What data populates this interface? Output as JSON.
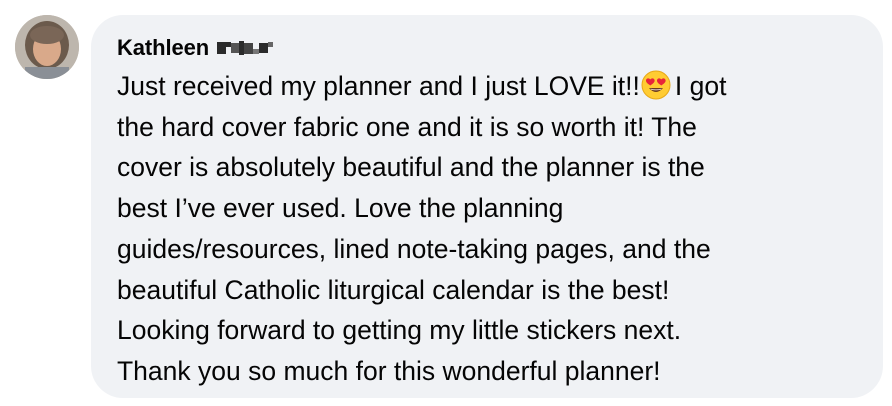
{
  "comment": {
    "author_name": "Kathleen",
    "author_surname_redacted": true,
    "emoji": "heart-eyes-emoji",
    "lines": {
      "l1_before": "Just received my planner and I just LOVE it!!",
      "l1_after": "I got",
      "l2": "the hard cover fabric one and it is so worth it! The",
      "l3": "cover is absolutely beautiful and the planner is the",
      "l4": "best I’ve ever used. Love the planning",
      "l5": "guides/resources, lined note-taking pages, and the",
      "l6": "beautiful Catholic liturgical calendar is the best!",
      "l7": "Looking forward to getting my little stickers next.",
      "l8": "Thank you so much for this wonderful planner!"
    }
  },
  "colors": {
    "bubble_bg": "#f0f2f5",
    "text": "#050505"
  }
}
